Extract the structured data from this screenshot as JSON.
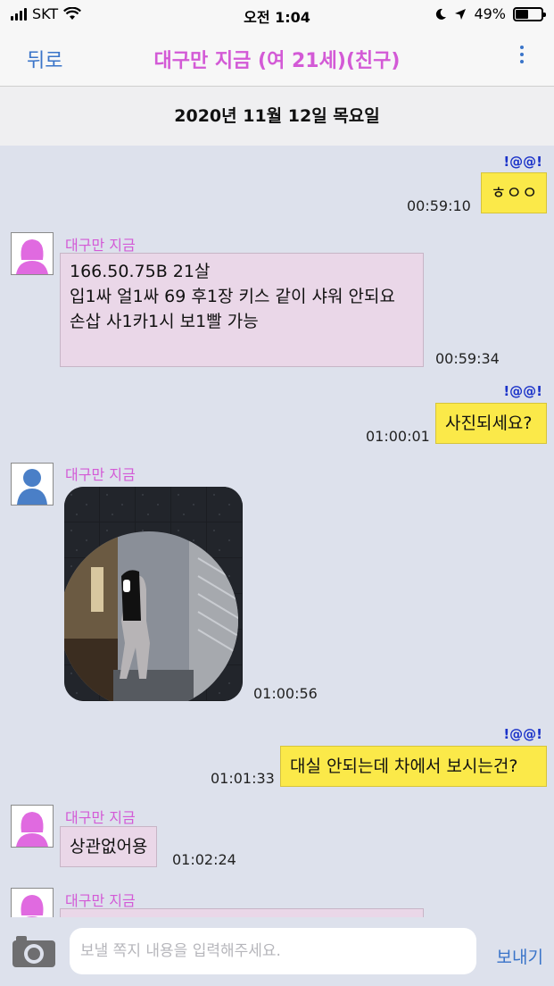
{
  "status": {
    "carrier": "SKT",
    "time": "오전 1:04",
    "battery": "49%",
    "battery_level": 0.49,
    "icons": [
      "signal-icon",
      "wifi-icon",
      "moon-icon",
      "location-icon",
      "battery-icon"
    ]
  },
  "nav": {
    "back_label": "뒤로",
    "title": "대구만 지금 (여 21세)(친구)",
    "more_icon": "more-vertical-icon"
  },
  "date_header": "2020년 11월 12일 목요일",
  "colors": {
    "accent": "#3a74c9",
    "title": "#d35ad6",
    "my_bubble": "#fbe949",
    "their_bubble": "#ead7e8",
    "background": "#dde1ec"
  },
  "messages": [
    {
      "from": "me",
      "tag": "!@@!",
      "text": "ㅎㅇㅇ",
      "time": "00:59:10"
    },
    {
      "from": "other",
      "sender": "대구만 지금",
      "avatar": "female-avatar-icon",
      "lines": [
        "166.50.75B 21살",
        "입1싸 얼1싸 69 후1장 키스 같이 샤워 안되요",
        "손삽 사1카1시 보1빨 가능"
      ],
      "time": "00:59:34"
    },
    {
      "from": "me",
      "tag": "!@@!",
      "text": "사진되세요?",
      "time": "01:00:01"
    },
    {
      "from": "other",
      "sender": "대구만 지금",
      "avatar": "male-avatar-icon",
      "photo": "mirror-selfie-photo",
      "time": "01:00:56"
    },
    {
      "from": "me",
      "tag": "!@@!",
      "text": "대실 안되는데 차에서 보시는건?",
      "time": "01:01:33"
    },
    {
      "from": "other",
      "sender": "대구만 지금",
      "avatar": "female-avatar-icon",
      "text": "상관없어용",
      "time": "01:02:24"
    },
    {
      "from": "other",
      "sender": "대구만 지금",
      "avatar": "female-avatar-icon"
    }
  ],
  "input": {
    "placeholder": "보낼 쪽지 내용을 입력해주세요.",
    "value": "",
    "send_label": "보내기",
    "camera_icon": "camera-icon"
  }
}
